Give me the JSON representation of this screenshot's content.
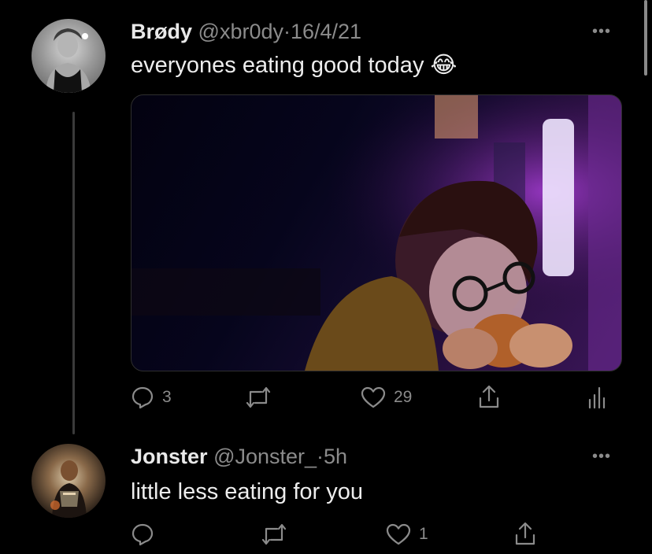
{
  "tweets": [
    {
      "author": "Brødy",
      "handle": "@xbr0dy",
      "separator": "·",
      "time": "16/4/21",
      "text": "everyones eating good today 😂",
      "more": "•••",
      "replies": "3",
      "retweets": "",
      "likes": "29"
    },
    {
      "author": "Jonster",
      "handle": "@Jonster_",
      "separator": "·",
      "time": "5h",
      "text": "little less eating for you",
      "more": "•••",
      "replies": "",
      "retweets": "",
      "likes": "1"
    }
  ],
  "icons": {
    "reply": "reply-icon",
    "retweet": "retweet-icon",
    "like": "heart-icon",
    "share": "share-icon",
    "analytics": "analytics-icon"
  }
}
